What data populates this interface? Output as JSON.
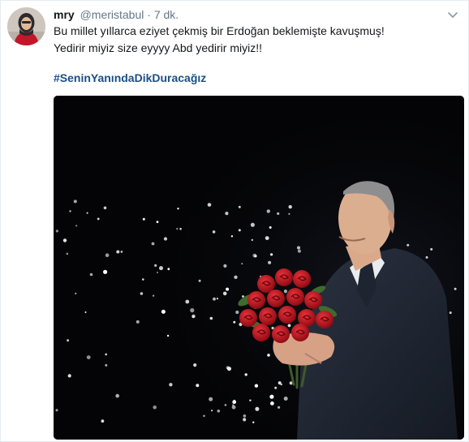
{
  "tweet": {
    "name": "mry",
    "handle": "@meristabul",
    "separator": "·",
    "time": "7 dk.",
    "text_line1": "Bu millet yıllarca eziyet çekmiş bir Erdoğan beklemişte kavuşmuş!",
    "text_line2": "Yedirir miyiz size eyyyy Abd yedirir miyiz!!",
    "hashtag": "#SeninYanındaDikDuracağız",
    "icons": {
      "caret": "chevron-down-icon"
    },
    "colors": {
      "name": "#14171a",
      "meta": "#657786",
      "hashtag": "#1b4f86",
      "photo_background": "#040406",
      "roses": "#c8101c"
    }
  }
}
